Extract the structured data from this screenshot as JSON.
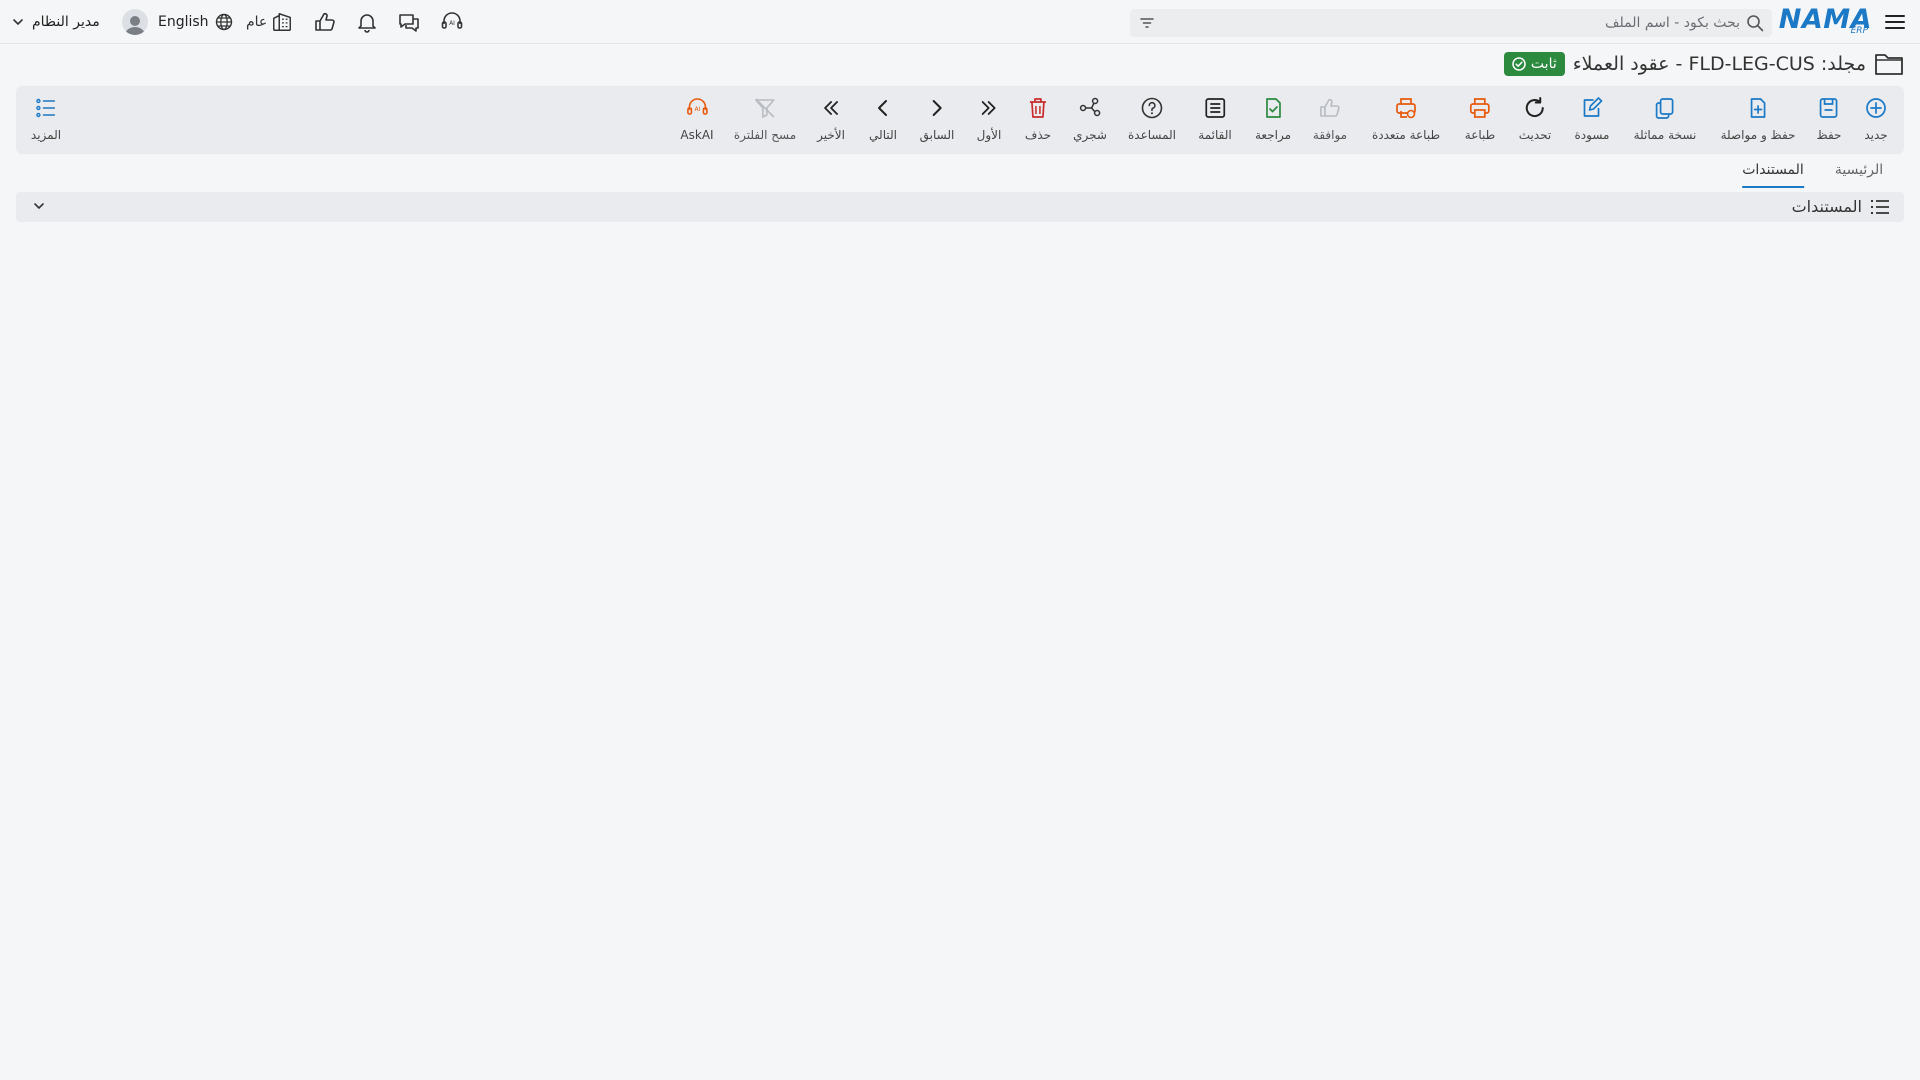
{
  "topbar": {
    "logo_text": "NAMA",
    "logo_sub": "ERP",
    "search_placeholder": "بحث بكود - اسم الملف",
    "generic_label": "عام",
    "language_label": "English",
    "user_name": "مدير النظام"
  },
  "title": {
    "text": "مجلد: FLD-LEG-CUS - عقود العملاء",
    "status_badge": "ثابت"
  },
  "toolbar": {
    "items": [
      {
        "label": "جديد",
        "icon": "plus-circle-icon"
      },
      {
        "label": "حفظ",
        "icon": "save-icon"
      },
      {
        "label": "حفظ و مواصلة",
        "icon": "save-continue-icon"
      },
      {
        "label": "نسخة مماثلة",
        "icon": "copy-icon"
      },
      {
        "label": "مسودة",
        "icon": "draft-icon"
      },
      {
        "label": "تحديث",
        "icon": "refresh-icon"
      },
      {
        "label": "طباعة",
        "icon": "print-icon"
      },
      {
        "label": "طباعة متعددة",
        "icon": "multi-print-icon"
      },
      {
        "label": "موافقة",
        "icon": "thumbs-up-icon"
      },
      {
        "label": "مراجعة",
        "icon": "review-icon"
      },
      {
        "label": "القائمة",
        "icon": "list-icon"
      },
      {
        "label": "المساعدة",
        "icon": "help-icon"
      },
      {
        "label": "شجري",
        "icon": "tree-icon"
      },
      {
        "label": "حذف",
        "icon": "trash-icon"
      },
      {
        "label": "الأول",
        "icon": "first-icon"
      },
      {
        "label": "السابق",
        "icon": "previous-icon"
      },
      {
        "label": "التالي",
        "icon": "next-icon"
      },
      {
        "label": "الأخير",
        "icon": "last-icon"
      },
      {
        "label": "مسح الفلترة",
        "icon": "clear-filter-icon"
      },
      {
        "label": "AskAI",
        "icon": "ask-ai-icon"
      }
    ],
    "more_label": "المزيد"
  },
  "tabs": [
    {
      "label": "الرئيسية",
      "active": false
    },
    {
      "label": "المستندات",
      "active": true
    }
  ],
  "section": {
    "title": "المستندات"
  },
  "colors": {
    "brand": "#1b79c6",
    "success": "#2b8a3e",
    "print": "#e8590c",
    "delete": "#c92a2a"
  }
}
